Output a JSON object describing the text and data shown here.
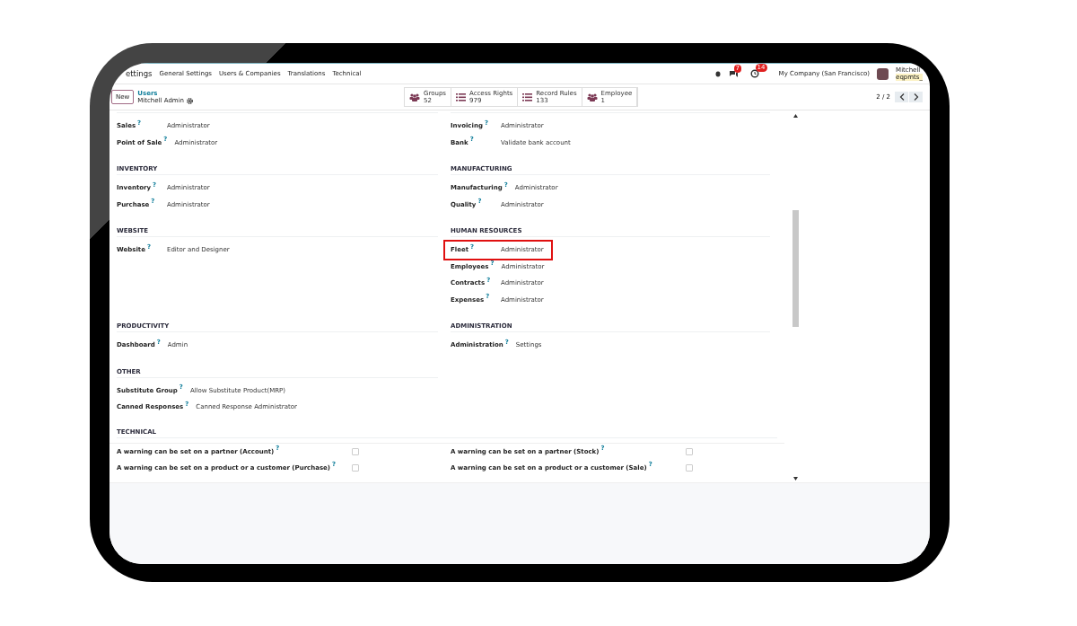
{
  "navbar": {
    "app": "ettings",
    "menu": [
      "General Settings",
      "Users & Companies",
      "Translations",
      "Technical"
    ],
    "chat_count": "7",
    "activity_count": "14",
    "company": "My Company (San Francisco)",
    "user_name": "Mitchell",
    "user_db": "eqpmts_"
  },
  "control_panel": {
    "new_button": "New",
    "breadcrumb": "Users",
    "record": "Mitchell Admin",
    "pager": "2 / 2",
    "smart_buttons": [
      {
        "kind": "groups",
        "label": "Groups",
        "count": "52"
      },
      {
        "kind": "list",
        "label": "Access Rights",
        "count": "979"
      },
      {
        "kind": "list",
        "label": "Record Rules",
        "count": "133"
      },
      {
        "kind": "groups",
        "label": "Employee",
        "count": "1"
      }
    ]
  },
  "groups": [
    {
      "fields": [
        {
          "label": "Sales",
          "help": "?",
          "value": "Administrator",
          "highlighted": false
        },
        {
          "label": "Point of Sale",
          "help": "?",
          "value": "Administrator",
          "highlighted": false
        }
      ]
    },
    {
      "fields": [
        {
          "label": "Invoicing",
          "help": "?",
          "value": "Administrator",
          "highlighted": false
        },
        {
          "label": "Bank",
          "help": "?",
          "value": "Validate bank account",
          "highlighted": false
        }
      ]
    },
    {
      "title": "INVENTORY",
      "fields": [
        {
          "label": "Inventory",
          "help": "?",
          "value": "Administrator",
          "highlighted": false
        },
        {
          "label": "Purchase",
          "help": "?",
          "value": "Administrator",
          "highlighted": false
        }
      ]
    },
    {
      "title": "MANUFACTURING",
      "fields": [
        {
          "label": "Manufacturing",
          "help": "?",
          "value": "Administrator",
          "highlighted": false
        },
        {
          "label": "Quality",
          "help": "?",
          "value": "Administrator",
          "highlighted": false
        }
      ]
    },
    {
      "title": "WEBSITE",
      "fields": [
        {
          "label": "Website",
          "help": "?",
          "value": "Editor and Designer",
          "highlighted": false
        }
      ]
    },
    {
      "title": "HUMAN RESOURCES",
      "fields": [
        {
          "label": "Fleet",
          "help": "?",
          "value": "Administrator",
          "highlighted": true
        },
        {
          "label": "Employees",
          "help": "?",
          "value": "Administrator",
          "highlighted": false
        },
        {
          "label": "Contracts",
          "help": "?",
          "value": "Administrator",
          "highlighted": false
        },
        {
          "label": "Expenses",
          "help": "?",
          "value": "Administrator",
          "highlighted": false
        }
      ]
    },
    {
      "title": "PRODUCTIVITY",
      "fields": [
        {
          "label": "Dashboard",
          "help": "?",
          "value": "Admin",
          "highlighted": false
        }
      ]
    },
    {
      "title": "ADMINISTRATION",
      "fields": [
        {
          "label": "Administration",
          "help": "?",
          "value": "Settings",
          "highlighted": false
        }
      ]
    },
    {
      "title": "OTHER",
      "fields": [
        {
          "label": "Substitute Group",
          "help": "?",
          "value": "Allow Substitute Product(MRP)",
          "highlighted": false
        },
        {
          "label": "Canned Responses",
          "help": "?",
          "value": "Canned Response Administrator",
          "highlighted": false
        }
      ]
    }
  ],
  "technical": {
    "title": "TECHNICAL",
    "options": [
      {
        "label": "A warning can be set on a partner (Account)",
        "help": "?",
        "checked": false
      },
      {
        "label": "A warning can be set on a partner (Stock)",
        "help": "?",
        "checked": false
      },
      {
        "label": "A warning can be set on a product or a customer (Purchase)",
        "help": "?",
        "checked": false
      },
      {
        "label": "A warning can be set on a product or a customer (Sale)",
        "help": "?",
        "checked": false
      }
    ]
  }
}
